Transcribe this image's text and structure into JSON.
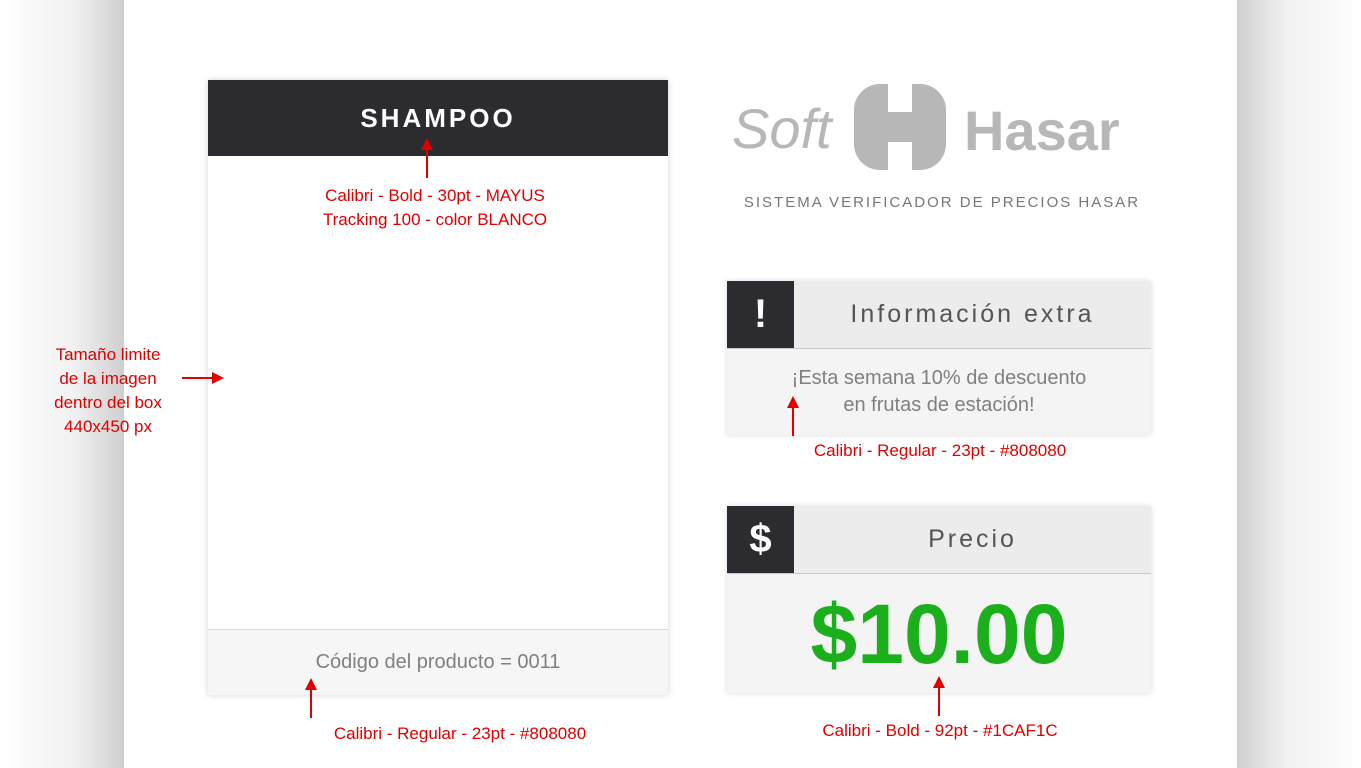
{
  "product": {
    "title": "SHAMPOO",
    "code_text": "Código del producto = 0011"
  },
  "logo": {
    "soft": "Soft",
    "hasar": "Hasar",
    "subtitle": "SISTEMA VERIFICADOR DE PRECIOS HASAR"
  },
  "info": {
    "icon": "!",
    "title": "Información extra",
    "line1": "¡Esta semana 10% de descuento",
    "line2": "en frutas de estación!"
  },
  "price": {
    "icon": "$",
    "title": "Precio",
    "value": "$10.00"
  },
  "annotations": {
    "title_line1": "Calibri - Bold - 30pt - MAYUS",
    "title_line2": "Tracking 100 - color BLANCO",
    "image_line1": "Tamaño limite",
    "image_line2": "de la imagen",
    "image_line3": "dentro del box",
    "image_line4": "440x450 px",
    "info_spec": "Calibri - Regular - 23pt - #808080",
    "code_spec": "Calibri - Regular - 23pt - #808080",
    "price_spec": "Calibri - Bold - 92pt - #1CAF1C"
  },
  "colors": {
    "header_bg": "#2b2b30",
    "price_green": "#1caf1c",
    "text_gray": "#808080",
    "annotation_red": "#e00000"
  }
}
